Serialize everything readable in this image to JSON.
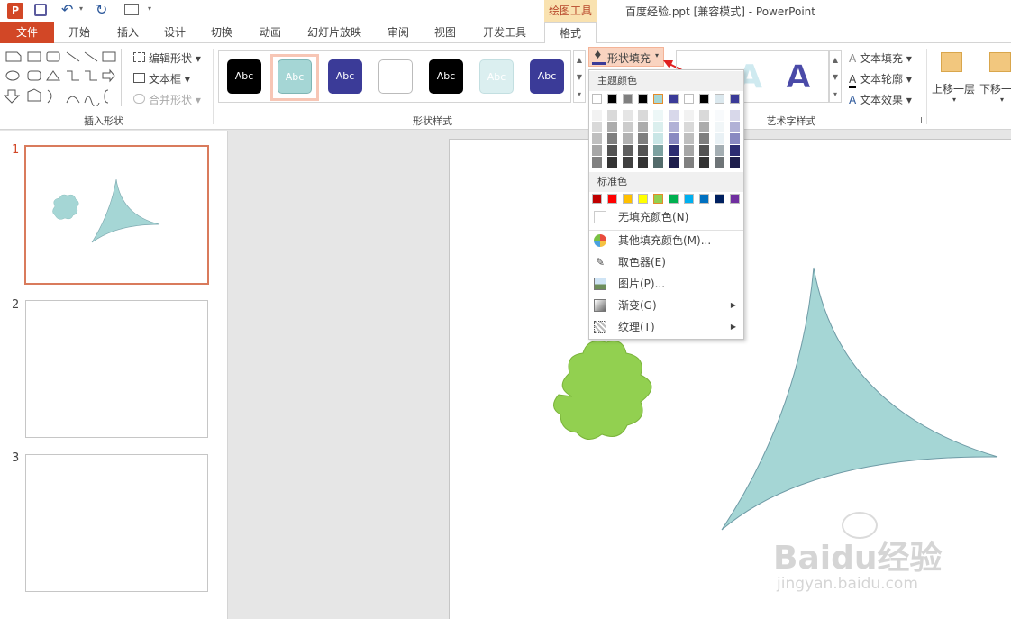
{
  "window": {
    "title": "百度经验.ppt [兼容模式] - PowerPoint"
  },
  "context_tab": "绘图工具",
  "tabs": [
    "文件",
    "开始",
    "插入",
    "设计",
    "切换",
    "动画",
    "幻灯片放映",
    "审阅",
    "视图",
    "开发工具",
    "格式"
  ],
  "ribbon": {
    "insert_shapes": {
      "label": "插入形状",
      "edit_shape": "编辑形状",
      "text_box": "文本框",
      "merge_shapes": "合并形状"
    },
    "shape_styles": {
      "label": "形状样式",
      "sample_text": "Abc"
    },
    "shape_fill": "形状填充",
    "wordart": {
      "label": "艺术字样式",
      "text_fill": "文本填充",
      "text_outline": "文本轮廓",
      "text_effect": "文本效果"
    },
    "arrange": {
      "bring_forward": "上移一层",
      "send_backward": "下移一"
    }
  },
  "slides": [
    {
      "number": "1"
    },
    {
      "number": "2"
    },
    {
      "number": "3"
    }
  ],
  "fill_menu": {
    "theme_colors_label": "主题颜色",
    "standard_colors_label": "标准色",
    "no_fill": "无填充颜色(N)",
    "more_colors": "其他填充颜色(M)...",
    "eyedropper": "取色器(E)",
    "picture": "图片(P)...",
    "gradient": "渐变(G)",
    "texture": "纹理(T)",
    "theme_top": [
      "#ffffff",
      "#000000",
      "#7f7f7f",
      "#000000",
      "#a5d6d5",
      "#3b3b98",
      "#ffffff",
      "#000000",
      "#dbe8ee",
      "#3b3b98"
    ],
    "standard": [
      "#c00000",
      "#ff0000",
      "#ffc000",
      "#ffff00",
      "#92d050",
      "#00b050",
      "#00b0f0",
      "#0070c0",
      "#002060",
      "#7030a0"
    ]
  },
  "watermark": {
    "brand": "Baidu经验",
    "url": "jingyan.baidu.com"
  }
}
